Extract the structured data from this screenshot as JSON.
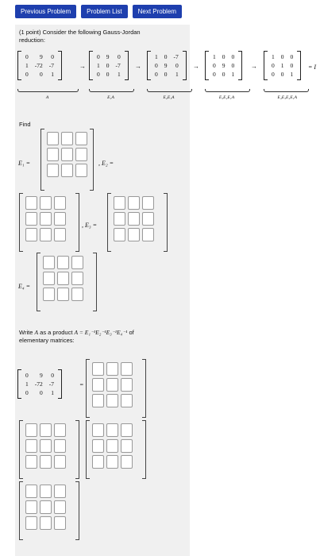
{
  "nav": {
    "prev": "Previous Problem",
    "list": "Problem List",
    "next": "Next Problem"
  },
  "problem": {
    "intro_line1": "(1 point) Consider the following Gauss-Jordan",
    "intro_line2": "reduction:",
    "find": "Find",
    "write_pre": "Write",
    "write_A": "A",
    "write_mid": "as a product",
    "write_formula": "A = E₁⁻¹E₂⁻¹E₃⁻¹E₄⁻¹",
    "write_post": "of",
    "write_line2": "elementary matrices:",
    "matrices": [
      [
        "0",
        "9",
        "0",
        "1",
        "-72",
        "-7",
        "0",
        "0",
        "1"
      ],
      [
        "0",
        "9",
        "0",
        "1",
        "0",
        "-7",
        "0",
        "0",
        "1"
      ],
      [
        "1",
        "0",
        "-7",
        "0",
        "9",
        "0",
        "0",
        "0",
        "1"
      ],
      [
        "1",
        "0",
        "0",
        "0",
        "9",
        "0",
        "0",
        "0",
        "1"
      ],
      [
        "1",
        "0",
        "0",
        "0",
        "1",
        "0",
        "0",
        "0",
        "1"
      ]
    ],
    "brace_labels": [
      "A",
      "E₁A",
      "E₂E₁A",
      "E₃E₂E₁A",
      "E₄E₃E₂E₁A"
    ],
    "eq_I": "= I",
    "labels": {
      "E1": "E₁ =",
      "E2": ", E₂ =",
      "E3": ", E₃ =",
      "E4": "E₄ =",
      "eq": "="
    }
  }
}
